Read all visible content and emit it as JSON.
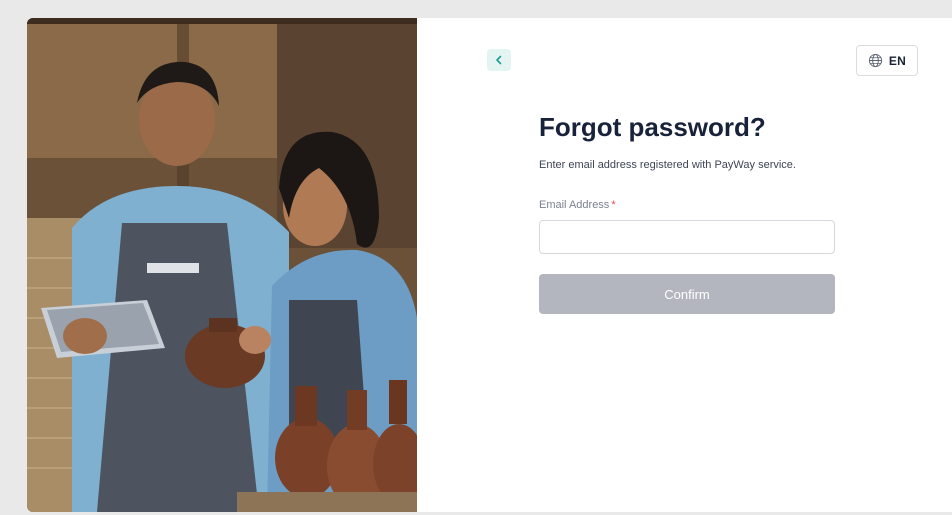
{
  "nav": {
    "back_icon": "chevron-left-icon",
    "language_icon": "globe-icon",
    "language_label": "EN"
  },
  "form": {
    "title": "Forgot password?",
    "subtitle": "Enter email address registered with PayWay service.",
    "email_label": "Email Address",
    "email_required_marker": "*",
    "email_value": "",
    "email_placeholder": "",
    "confirm_label": "Confirm"
  },
  "colors": {
    "accent": "#e3f4f3",
    "title": "#18223a",
    "button_disabled": "#b3b6be",
    "required": "#e5484d"
  }
}
